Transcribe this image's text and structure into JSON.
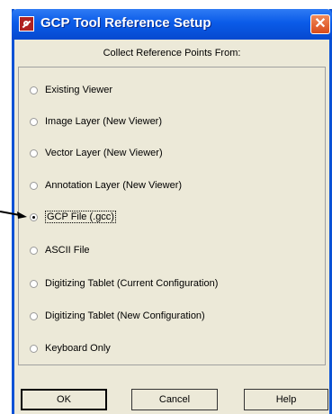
{
  "window": {
    "title": "GCP Tool Reference Setup",
    "close_glyph": "✕"
  },
  "group": {
    "label": "Collect Reference Points From:"
  },
  "options": [
    {
      "label": "Existing Viewer",
      "checked": false
    },
    {
      "label": "Image Layer (New Viewer)",
      "checked": false
    },
    {
      "label": "Vector Layer (New Viewer)",
      "checked": false
    },
    {
      "label": "Annotation Layer (New Viewer)",
      "checked": false
    },
    {
      "label": "GCP File (.gcc)",
      "checked": true
    },
    {
      "label": "ASCII File",
      "checked": false
    },
    {
      "label": "Digitizing Tablet (Current Configuration)",
      "checked": false
    },
    {
      "label": "Digitizing Tablet (New Configuration)",
      "checked": false
    },
    {
      "label": "Keyboard Only",
      "checked": false
    }
  ],
  "buttons": {
    "ok": "OK",
    "cancel": "Cancel",
    "help": "Help"
  },
  "colors": {
    "titlebar": "#0a5be8",
    "window_bg": "#ece9d8",
    "close": "#d84a1a"
  }
}
